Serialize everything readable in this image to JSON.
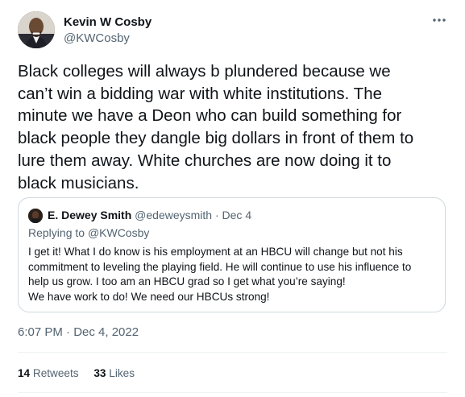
{
  "author": {
    "name": "Kevin W Cosby",
    "handle": "@KWCosby"
  },
  "tweet": {
    "text": "Black colleges will always b plundered because we\ncan’t win a bidding war with white institutions. The\nminute we have a Deon who can build something for\nblack people they dangle big dollars in front of them to\nlure them away. White churches are now doing it to\nblack musicians.",
    "timestamp": "6:07 PM · Dec 4, 2022"
  },
  "quoted_tweet": {
    "name": "E. Dewey Smith",
    "handle": "@edeweysmith",
    "separator": " · ",
    "date": "Dec 4",
    "replying_to_prefix": "Replying to ",
    "replying_to_handle": "@KWCosby",
    "text": "I get it!  What I do know is his employment at an HBCU will change but not his\ncommitment to leveling the playing field.   He will continue to use his influence to\nhelp us grow.  I too am an HBCU grad so I get what you’re saying!\nWe have work to do!   We need our HBCUs strong!"
  },
  "stats": {
    "retweets_count": "14",
    "retweets_label": "Retweets",
    "likes_count": "33",
    "likes_label": "Likes"
  },
  "icons": {
    "more": "more-horizontal-icon"
  },
  "colors": {
    "text_primary": "#0f1419",
    "text_secondary": "#536471",
    "border": "#cfd9de"
  }
}
